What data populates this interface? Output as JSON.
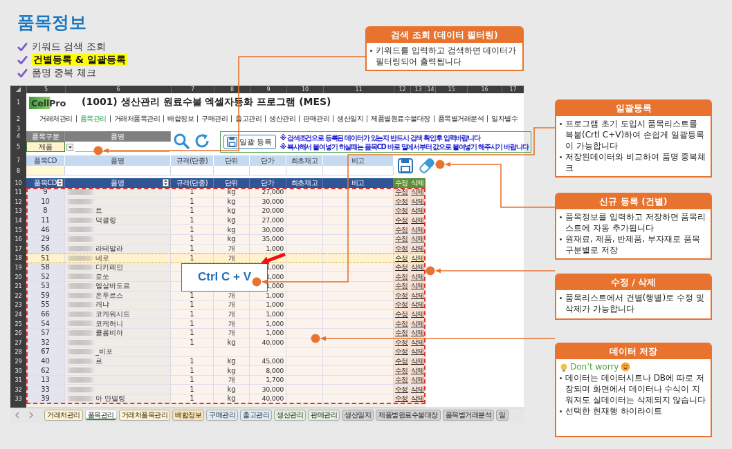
{
  "page_title": "품목정보",
  "features": [
    {
      "text": "키워드 검색 조회",
      "highlighted": false
    },
    {
      "text": "건별등록 & 일괄등록",
      "highlighted": true
    },
    {
      "text": "품명 중복 체크",
      "highlighted": false
    }
  ],
  "sheet": {
    "column_letters": [
      "5",
      "6",
      "7",
      "8",
      "9",
      "10",
      "11",
      "12",
      "13",
      "14",
      "15",
      "16",
      "17"
    ],
    "row_numbers": [
      "1",
      "2",
      "3",
      "4",
      "5",
      "7",
      "8",
      "10"
    ],
    "logo": "CellPro",
    "title": "(1001) 생산관리 원료수불 엑셀자동화 프로그램 (MES)",
    "nav": [
      {
        "label": "거래처관리",
        "selected": false
      },
      {
        "label": "품목관리",
        "selected": true
      },
      {
        "label": "거래처품목관리",
        "selected": false
      },
      {
        "label": "배합정보",
        "selected": false
      },
      {
        "label": "구매관리",
        "selected": false
      },
      {
        "label": "출고관리",
        "selected": false
      },
      {
        "label": "생산관리",
        "selected": false
      },
      {
        "label": "판매관리",
        "selected": false
      },
      {
        "label": "생산일지",
        "selected": false
      },
      {
        "label": "제품별원료수불대장",
        "selected": false
      },
      {
        "label": "품목별거래분석",
        "selected": false
      },
      {
        "label": "일자별수",
        "selected": false
      }
    ],
    "search_labels": [
      "품목구분",
      "품명"
    ],
    "category_value": "제품",
    "bulk_button": "일괄 등록",
    "notes": [
      "※ 검색조건으로 등록된 데이터가 있는지 반드시 검색 확인후 입력바랍니다",
      "※ 복사해서 붙여넣기 하실때는 품목CD 바로 밑에서부터 값으로 붙여넣기 해주시기 바랍니다"
    ],
    "entry_columns": [
      "품목CD",
      "품명",
      "규격(단중)",
      "단위",
      "단가",
      "최초재고",
      "비고"
    ],
    "list_columns": [
      "품목CD",
      "품명",
      "규격(단중)",
      "단위",
      "단가",
      "최초재고",
      "비고",
      "수정",
      "삭제"
    ],
    "rows": [
      {
        "row_number": "11",
        "code": "9",
        "spec": "1",
        "unit": "kg",
        "price": "27,000",
        "edit": "수정",
        "delete": "삭제",
        "selected": false
      },
      {
        "row_number": "12",
        "code": "10",
        "spec": "1",
        "unit": "kg",
        "price": "30,000",
        "edit": "수정",
        "delete": "삭제",
        "selected": false
      },
      {
        "row_number": "13",
        "code": "8",
        "name": "트",
        "spec": "1",
        "unit": "kg",
        "price": "20,000",
        "edit": "수정",
        "delete": "삭제",
        "selected": false
      },
      {
        "row_number": "14",
        "code": "11",
        "name": "덕클링",
        "spec": "1",
        "unit": "kg",
        "price": "27,000",
        "edit": "수정",
        "delete": "삭제",
        "selected": false
      },
      {
        "row_number": "15",
        "code": "46",
        "spec": "1",
        "unit": "kg",
        "price": "30,000",
        "edit": "수정",
        "delete": "삭제",
        "selected": false
      },
      {
        "row_number": "16",
        "code": "29",
        "spec": "1",
        "unit": "kg",
        "price": "35,000",
        "edit": "수정",
        "delete": "삭제",
        "selected": false
      },
      {
        "row_number": "17",
        "code": "56",
        "name": "라테말라",
        "spec": "1",
        "unit": "개",
        "price": "1,000",
        "edit": "수정",
        "delete": "삭제",
        "selected": false
      },
      {
        "row_number": "18",
        "code": "51",
        "name": "네로",
        "spec": "1",
        "unit": "개",
        "edit": "수정",
        "delete": "삭제",
        "selected": true
      },
      {
        "row_number": "19",
        "code": "58",
        "name": "디카페인",
        "price": "1,000",
        "edit": "수정",
        "delete": "삭제",
        "selected": false
      },
      {
        "row_number": "20",
        "code": "52",
        "name": "로쏘",
        "price": "1,000",
        "edit": "수정",
        "delete": "삭제",
        "selected": false
      },
      {
        "row_number": "21",
        "code": "53",
        "name": "엘살바도르",
        "price": "1,000",
        "edit": "수정",
        "delete": "삭제",
        "selected": false
      },
      {
        "row_number": "22",
        "code": "59",
        "name": "온두르스",
        "spec": "1",
        "unit": "개",
        "price": "1,000",
        "edit": "수정",
        "delete": "삭제",
        "selected": false
      },
      {
        "row_number": "23",
        "code": "55",
        "name": "캐냐",
        "spec": "1",
        "unit": "개",
        "price": "1,000",
        "edit": "수정",
        "delete": "삭제",
        "selected": false
      },
      {
        "row_number": "24",
        "code": "66",
        "name": "코케워시드",
        "spec": "1",
        "unit": "개",
        "price": "1,000",
        "edit": "수정",
        "delete": "삭제",
        "selected": false
      },
      {
        "row_number": "25",
        "code": "54",
        "name": "코케허니",
        "spec": "1",
        "unit": "개",
        "price": "1,000",
        "edit": "수정",
        "delete": "삭제",
        "selected": false
      },
      {
        "row_number": "26",
        "code": "57",
        "name": "콜롬비아",
        "spec": "1",
        "unit": "개",
        "price": "1,000",
        "edit": "수정",
        "delete": "삭제",
        "selected": false
      },
      {
        "row_number": "27",
        "code": "32",
        "spec": "1",
        "unit": "kg",
        "price": "40,000",
        "edit": "수정",
        "delete": "삭제",
        "selected": false
      },
      {
        "row_number": "28",
        "code": "67",
        "name": "_비포",
        "edit": "수정",
        "delete": "삭제",
        "selected": false
      },
      {
        "row_number": "29",
        "code": "40",
        "name": "르",
        "spec": "1",
        "unit": "kg",
        "price": "45,000",
        "edit": "수정",
        "delete": "삭제",
        "selected": false
      },
      {
        "row_number": "30",
        "code": "62",
        "spec": "1",
        "unit": "kg",
        "price": "8,000",
        "edit": "수정",
        "delete": "삭제",
        "selected": false
      },
      {
        "row_number": "31",
        "code": "13",
        "spec": "1",
        "unit": "개",
        "price": "1,700",
        "edit": "수정",
        "delete": "삭제",
        "selected": false
      },
      {
        "row_number": "32",
        "code": "33",
        "spec": "1",
        "unit": "kg",
        "price": "30,000",
        "edit": "수정",
        "delete": "삭제",
        "selected": false
      },
      {
        "row_number": "33",
        "code": "39",
        "name": "아 만델링",
        "spec": "1",
        "unit": "kg",
        "price": "40,000",
        "edit": "수정",
        "delete": "삭제",
        "selected": false
      }
    ],
    "tabs": [
      {
        "label": "거래처관리",
        "color": "#fff2cc",
        "selected": false
      },
      {
        "label": "품목관리",
        "color": "#ffffff",
        "selected": true
      },
      {
        "label": "거래처품목관리",
        "color": "#fff2cc",
        "selected": false
      },
      {
        "label": "배합정보",
        "color": "#fce4b4",
        "selected": false
      },
      {
        "label": "구매관리",
        "color": "#ddebf7",
        "selected": false
      },
      {
        "label": "출고관리",
        "color": "#ddebf7",
        "selected": false
      },
      {
        "label": "생산관리",
        "color": "#e2efda",
        "selected": false
      },
      {
        "label": "판매관리",
        "color": "#e2efda",
        "selected": false
      },
      {
        "label": "생산일지",
        "color": "#d0d0d0",
        "selected": false
      },
      {
        "label": "제품별원료수불대장",
        "color": "#d0d0d0",
        "selected": false
      },
      {
        "label": "품목별거래분석",
        "color": "#d0d0d0",
        "selected": false
      },
      {
        "label": "일",
        "color": "#d0d0d0",
        "selected": false
      }
    ]
  },
  "shortcut_label": "Ctrl C + V",
  "callouts": [
    {
      "title": "검색 조회 (데이터 필터링)",
      "bullets": [
        "키워드를 입력하고 검색하면 데이터가 필터링되어 출력됩니다"
      ]
    },
    {
      "title": "일괄등록",
      "bullets": [
        "프로그램 초기 도입시 품목리스트를 복붙(Crtl C+V)하여 손쉽게 일괄등록이 가능합니다",
        "저장된데이터와 비교하여 품명 중복체크"
      ]
    },
    {
      "title": "신규 등록 (건별)",
      "bullets": [
        "품목정보를 입력하고 저장하면 품목리스트에 자동 추가됩니다",
        "원재료, 제품, 반제품, 부자재로 품목 구분별로 저장"
      ]
    },
    {
      "title": "수정 / 삭제",
      "bullets": [
        "품목리스트에서 건별(행별)로 수정 및 삭제가 가능합니다"
      ]
    },
    {
      "title": "데이터 저장",
      "tip": "Don’t worry",
      "bullets": [
        "데이터는 데이터시트나 DB에 따로 저장되며 화면에서 데이터나 수식이 지워져도 실데이터는 삭제되지 않습니다",
        "선택한 현재행 하이라이트"
      ]
    }
  ]
}
